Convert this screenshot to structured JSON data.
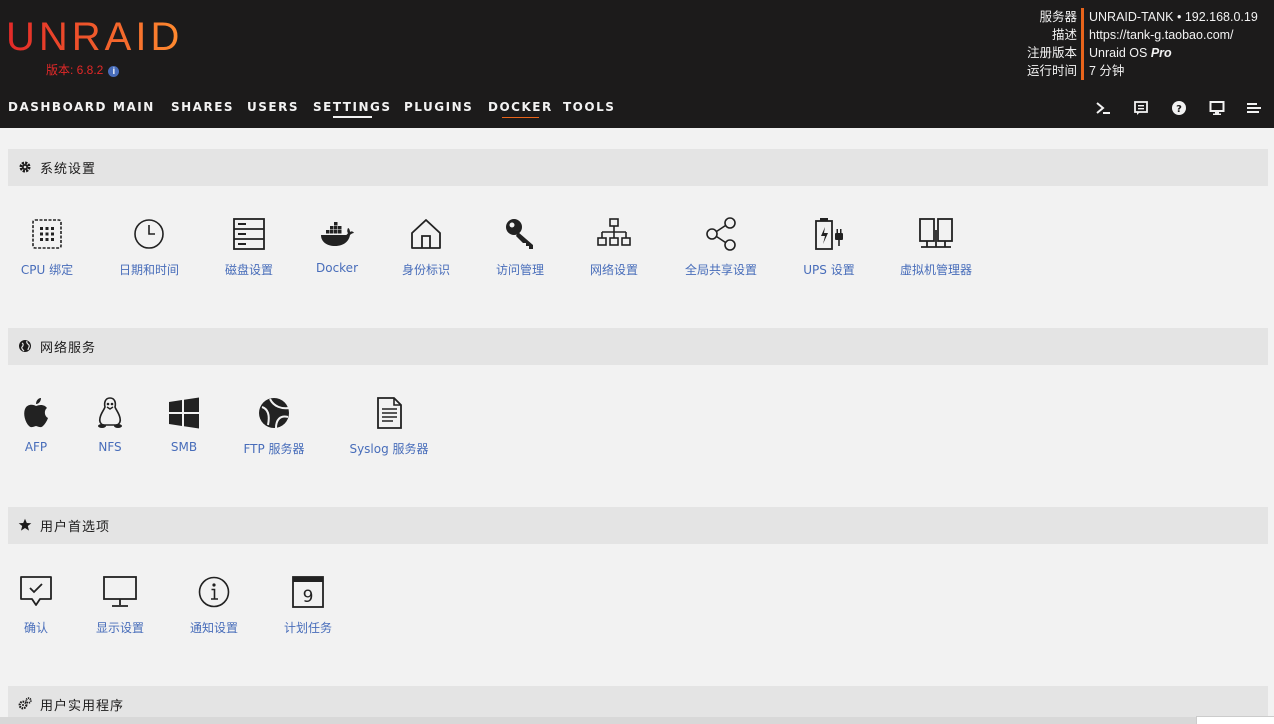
{
  "header": {
    "logo": "UNRAID",
    "version": "版本: 6.8.2",
    "server_info": {
      "labels": [
        "服务器",
        "描述",
        "注册版本",
        "运行时间"
      ],
      "server": "UNRAID-TANK • 192.168.0.19",
      "description": "https://tank-g.taobao.com/",
      "registration_prefix": "Unraid OS",
      "registration_edition": "Pro",
      "uptime": "7 分钟"
    },
    "nav": [
      {
        "label": "DASHBOARD"
      },
      {
        "label": "MAIN"
      },
      {
        "label": "SHARES"
      },
      {
        "label": "USERS"
      },
      {
        "label": "SETTINGS"
      },
      {
        "label": "PLUGINS"
      },
      {
        "label": "DOCKER"
      },
      {
        "label": "TOOLS"
      }
    ],
    "right_icons": [
      "terminal-icon",
      "notes-icon",
      "help-icon",
      "display-icon",
      "log-icon"
    ]
  },
  "sections": [
    {
      "title": "系统设置",
      "icon": "gear-icon",
      "items": [
        {
          "label": "CPU 绑定",
          "icon": "cpu-icon"
        },
        {
          "label": "日期和时间",
          "icon": "clock-icon"
        },
        {
          "label": "磁盘设置",
          "icon": "disk-icon"
        },
        {
          "label": "Docker",
          "icon": "docker-icon"
        },
        {
          "label": "身份标识",
          "icon": "home-icon"
        },
        {
          "label": "访问管理",
          "icon": "key-icon"
        },
        {
          "label": "网络设置",
          "icon": "network-icon"
        },
        {
          "label": "全局共享设置",
          "icon": "share-icon"
        },
        {
          "label": "UPS 设置",
          "icon": "battery-icon"
        },
        {
          "label": "虚拟机管理器",
          "icon": "vm-icon"
        }
      ]
    },
    {
      "title": "网络服务",
      "icon": "globe-icon",
      "items": [
        {
          "label": "AFP",
          "icon": "apple-icon"
        },
        {
          "label": "NFS",
          "icon": "linux-icon"
        },
        {
          "label": "SMB",
          "icon": "windows-icon"
        },
        {
          "label": "FTP 服务器",
          "icon": "ftp-icon"
        },
        {
          "label": "Syslog 服务器",
          "icon": "document-icon"
        }
      ]
    },
    {
      "title": "用户首选项",
      "icon": "star-icon",
      "items": [
        {
          "label": "确认",
          "icon": "confirm-icon"
        },
        {
          "label": "显示设置",
          "icon": "monitor-icon"
        },
        {
          "label": "通知设置",
          "icon": "info-icon"
        },
        {
          "label": "计划任务",
          "icon": "calendar-icon"
        }
      ]
    },
    {
      "title": "用户实用程序",
      "icon": "gears-icon",
      "items": []
    }
  ],
  "colors": {
    "accent": "#e8641b",
    "link": "#486dba",
    "header_bg": "#1c1b1b"
  }
}
